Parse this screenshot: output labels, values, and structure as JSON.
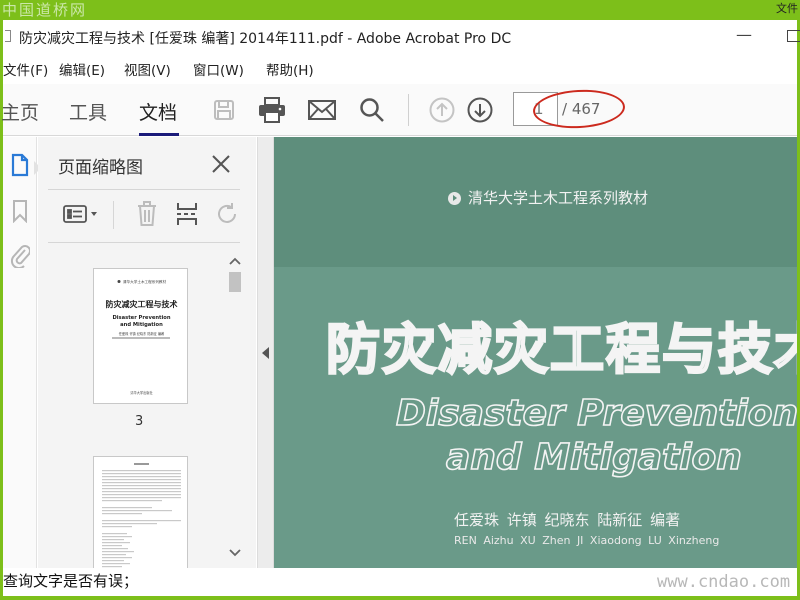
{
  "watermark": {
    "top": "中国道桥网",
    "bottom": "www.cndao.com"
  },
  "top_edge_text": "文件",
  "window": {
    "title": "防灾减灾工程与技术 [任爱珠 编著] 2014年111.pdf - Adobe Acrobat Pro DC",
    "minimize": "—"
  },
  "menu": [
    {
      "label": "文件(F)"
    },
    {
      "label": "编辑(E)"
    },
    {
      "label": "视图(V)"
    },
    {
      "label": "窗口(W)"
    },
    {
      "label": "帮助(H)"
    }
  ],
  "nav_tabs": [
    {
      "label": "主页"
    },
    {
      "label": "工具"
    },
    {
      "label": "文档"
    }
  ],
  "page_nav": {
    "current": "1",
    "total": "/ 467"
  },
  "panel": {
    "title": "页面缩略图",
    "thumbnail_page_number": "3"
  },
  "thumb1": {
    "series": "清华大学土木工程系列教材",
    "title": "防灾减灾工程与技术",
    "en1": "Disaster Prevention",
    "en2": "and Mitigation",
    "authors": "任爱珠 许镇 纪晓东 陆新征 编著",
    "publisher": "清华大学出版社"
  },
  "document": {
    "series": "清华大学土木工程系列教材",
    "cn_title": "防灾减灾工程与技术",
    "en_title_1": "Disaster Prevention",
    "en_title_2": "and Mitigation",
    "authors_cn": "任爱珠 许镇 纪晓东 陆新征 编著",
    "authors_en": "REN Aizhu XU Zhen JI Xiaodong LU Xinzheng"
  },
  "bottom_clip_text": "查询文字是否有误；",
  "colors": {
    "frame": "#7dbf1a",
    "cover": "#6a9a89",
    "highlight_circle": "#cc2a1e",
    "active_tab": "#1b1b7a"
  },
  "icons": {
    "toolbar": [
      "save-icon",
      "print-icon",
      "mail-icon",
      "search-icon",
      "page-up-icon",
      "page-down-icon"
    ],
    "rail": [
      "page-thumbnails-icon",
      "bookmark-icon",
      "attachment-icon"
    ],
    "panel": [
      "options-menu-icon",
      "delete-icon",
      "insert-page-icon",
      "rotate-icon",
      "close-icon"
    ]
  }
}
